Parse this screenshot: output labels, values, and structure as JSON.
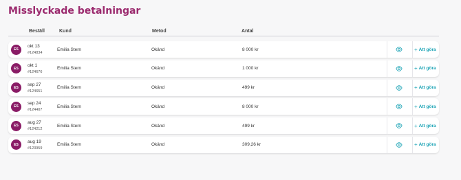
{
  "page": {
    "title": "Misslyckade betalningar"
  },
  "columns": {
    "order": "Beställ",
    "customer": "Kund",
    "method": "Metod",
    "amount": "Antal"
  },
  "colors": {
    "title": "#9b2a6e",
    "avatar": "#8a1c66",
    "accent": "#1aa3b5"
  },
  "rows": [
    {
      "initials": "ES",
      "date": "okt 13",
      "order": "#124834",
      "customer": "Emilia Stern",
      "method": "Okänd",
      "amount": "8 000 kr",
      "action": "Att göra"
    },
    {
      "initials": "ES",
      "date": "okt 1",
      "order": "#124676",
      "customer": "Emilia Stern",
      "method": "Okänd",
      "amount": "1 000 kr",
      "action": "Att göra"
    },
    {
      "initials": "ES",
      "date": "sep 27",
      "order": "#124651",
      "customer": "Emilia Stern",
      "method": "Okänd",
      "amount": "499 kr",
      "action": "Att göra"
    },
    {
      "initials": "ES",
      "date": "sep 24",
      "order": "#124407",
      "customer": "Emilia Stern",
      "method": "Okänd",
      "amount": "8 000 kr",
      "action": "Att göra"
    },
    {
      "initials": "ES",
      "date": "aug 27",
      "order": "#124212",
      "customer": "Emilia Stern",
      "method": "Okänd",
      "amount": "499 kr",
      "action": "Att göra"
    },
    {
      "initials": "ES",
      "date": "aug 19",
      "order": "#123959",
      "customer": "Emilia Stern",
      "method": "Okänd",
      "amount": "309,26 kr",
      "action": "Att göra"
    }
  ]
}
